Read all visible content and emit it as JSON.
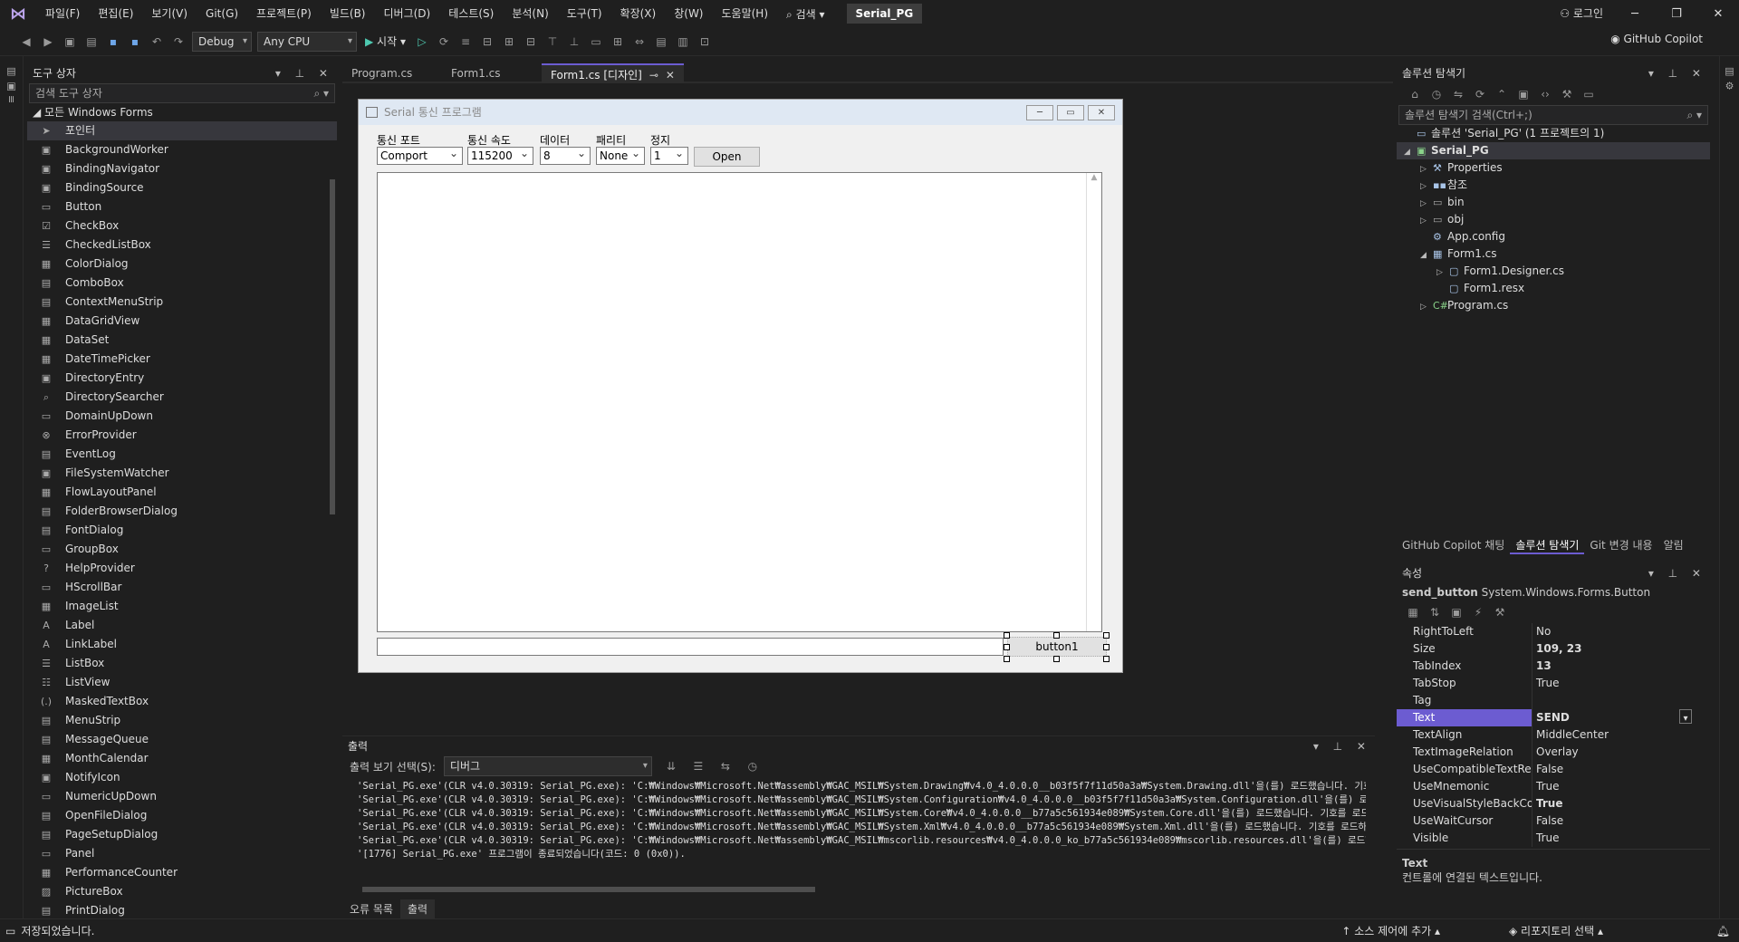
{
  "menu": {
    "items": [
      "파일(F)",
      "편집(E)",
      "보기(V)",
      "Git(G)",
      "프로젝트(P)",
      "빌드(B)",
      "디버그(D)",
      "테스트(S)",
      "분석(N)",
      "도구(T)",
      "확장(X)",
      "창(W)",
      "도움말(H)"
    ],
    "search": "검색",
    "solution_title": "Serial_PG",
    "login": "로그인"
  },
  "toolbar": {
    "config": "Debug",
    "platform": "Any CPU",
    "start": "시작",
    "copilot": "GitHub Copilot"
  },
  "toolbox": {
    "title": "도구 상자",
    "search_placeholder": "검색 도구 상자",
    "group": "모든 Windows Forms",
    "items": [
      "포인터",
      "BackgroundWorker",
      "BindingNavigator",
      "BindingSource",
      "Button",
      "CheckBox",
      "CheckedListBox",
      "ColorDialog",
      "ComboBox",
      "ContextMenuStrip",
      "DataGridView",
      "DataSet",
      "DateTimePicker",
      "DirectoryEntry",
      "DirectorySearcher",
      "DomainUpDown",
      "ErrorProvider",
      "EventLog",
      "FileSystemWatcher",
      "FlowLayoutPanel",
      "FolderBrowserDialog",
      "FontDialog",
      "GroupBox",
      "HelpProvider",
      "HScrollBar",
      "ImageList",
      "Label",
      "LinkLabel",
      "ListBox",
      "ListView",
      "MaskedTextBox",
      "MenuStrip",
      "MessageQueue",
      "MonthCalendar",
      "NotifyIcon",
      "NumericUpDown",
      "OpenFileDialog",
      "PageSetupDialog",
      "Panel",
      "PerformanceCounter",
      "PictureBox",
      "PrintDialog"
    ]
  },
  "tabs": [
    {
      "label": "Program.cs"
    },
    {
      "label": "Form1.cs"
    },
    {
      "label": "Form1.cs [디자인]"
    }
  ],
  "form": {
    "title": "Serial 통신 프로그램",
    "labels": {
      "port": "통신 포트",
      "speed": "통신 속도",
      "data": "데이터",
      "parity": "패리티",
      "stop": "정지"
    },
    "combos": {
      "port": "Comport",
      "speed": "115200",
      "data": "8",
      "parity": "None",
      "stop": "1"
    },
    "open_button": "Open",
    "button1": "button1"
  },
  "output": {
    "title": "출력",
    "source_label": "출력 보기 선택(S):",
    "source_value": "디버그",
    "lines": [
      "'Serial_PG.exe'(CLR v4.0.30319: Serial_PG.exe): 'C:₩Windows₩Microsoft.Net₩assembly₩GAC_MSIL₩System.Drawing₩v4.0_4.0.0.0__b03f5f7f11d50a3a₩System.Drawing.dll'을(를) 로드했습니다. 기호를 로",
      "'Serial_PG.exe'(CLR v4.0.30319: Serial_PG.exe): 'C:₩Windows₩Microsoft.Net₩assembly₩GAC_MSIL₩System.Configuration₩v4.0_4.0.0.0__b03f5f7f11d50a3a₩System.Configuration.dll'을(를) 로드했습니다LIC",
      "'Serial_PG.exe'(CLR v4.0.30319: Serial_PG.exe): 'C:₩Windows₩Microsoft.Net₩assembly₩GAC_MSIL₩System.Core₩v4.0_4.0.0.0__b77a5c561934e089₩System.Core.dll'을(를) 로드했습니다. 기호를 로드하지",
      "'Serial_PG.exe'(CLR v4.0.30319: Serial_PG.exe): 'C:₩Windows₩Microsoft.Net₩assembly₩GAC_MSIL₩System.Xml₩v4.0_4.0.0.0__b77a5c561934e089₩System.Xml.dll'을(를) 로드했습니다. 기호를 로드하지 않",
      "'Serial_PG.exe'(CLR v4.0.30319: Serial_PG.exe): 'C:₩Windows₩Microsoft.Net₩assembly₩GAC_MSIL₩mscorlib.resources₩v4.0_4.0.0.0_ko_b77a5c561934e089₩mscorlib.resources.dll'을(를) 로드했습니다.",
      "'[1776] Serial_PG.exe' 프로그램이 종료되었습니다(코드: 0 (0x0))."
    ],
    "bottom_tabs": [
      "오류 목록",
      "출력"
    ]
  },
  "solution": {
    "title": "솔루션 탐색기",
    "search_placeholder": "솔루션 탐색기 검색(Ctrl+;)",
    "root": "솔루션 'Serial_PG' (1 프로젝트의 1)",
    "project": "Serial_PG",
    "items": {
      "properties": "Properties",
      "references": "참조",
      "bin": "bin",
      "obj": "obj",
      "appconfig": "App.config",
      "form1": "Form1.cs",
      "designer": "Form1.Designer.cs",
      "resx": "Form1.resx",
      "program": "Program.cs"
    },
    "bottom_tabs": [
      "GitHub Copilot 채팅",
      "솔루션 탐색기",
      "Git 변경 내용",
      "알림"
    ]
  },
  "properties": {
    "title": "속성",
    "object_name": "send_button",
    "object_type": "System.Windows.Forms.Button",
    "rows": [
      {
        "name": "RightToLeft",
        "value": "No"
      },
      {
        "name": "Size",
        "value": "109, 23"
      },
      {
        "name": "TabIndex",
        "value": "13"
      },
      {
        "name": "TabStop",
        "value": "True"
      },
      {
        "name": "Tag",
        "value": ""
      },
      {
        "name": "Text",
        "value": "SEND"
      },
      {
        "name": "TextAlign",
        "value": "MiddleCenter"
      },
      {
        "name": "TextImageRelation",
        "value": "Overlay"
      },
      {
        "name": "UseCompatibleTextRenderir",
        "value": "False"
      },
      {
        "name": "UseMnemonic",
        "value": "True"
      },
      {
        "name": "UseVisualStyleBackColor",
        "value": "True"
      },
      {
        "name": "UseWaitCursor",
        "value": "False"
      },
      {
        "name": "Visible",
        "value": "True"
      }
    ],
    "desc_title": "Text",
    "desc_text": "컨트롤에 연결된 텍스트입니다."
  },
  "status": {
    "message": "저장되었습니다.",
    "source_control": "소스 제어에 추가",
    "repo": "리포지토리 선택"
  },
  "colors": {
    "accent": "#6c5cd1",
    "background": "#1f1f1f"
  }
}
